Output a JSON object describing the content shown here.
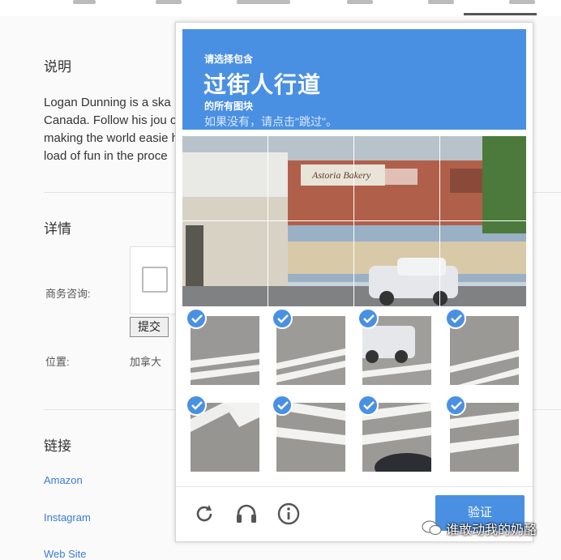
{
  "profile": {
    "description_heading": "说明",
    "description_text": "Logan Dunning is a ska                                                                    nto, O\nCanada.  Follow his jou                                                                      oard t\nmaking the world easie                                                                       havin\nload of fun in the proce",
    "details_heading": "详情",
    "business_label": "商务咨询:",
    "submit_label": "提交",
    "location_label": "位置:",
    "location_value": "加拿大",
    "links_heading": "链接",
    "links": [
      "Amazon",
      "Instagram",
      "Web Site"
    ]
  },
  "captcha": {
    "prompt_small": "请选择包含",
    "prompt_target": "过街人行道",
    "prompt_suffix": "的所有图块",
    "prompt_hint": "如果没有，请点击\"跳过\"。",
    "verify_label": "验证",
    "icons": [
      "reload-icon",
      "audio-icon",
      "info-icon"
    ],
    "selected_tiles": 8,
    "accent_color": "#4a90e2"
  },
  "watermark": {
    "text": "谁敢动我的奶酪"
  }
}
